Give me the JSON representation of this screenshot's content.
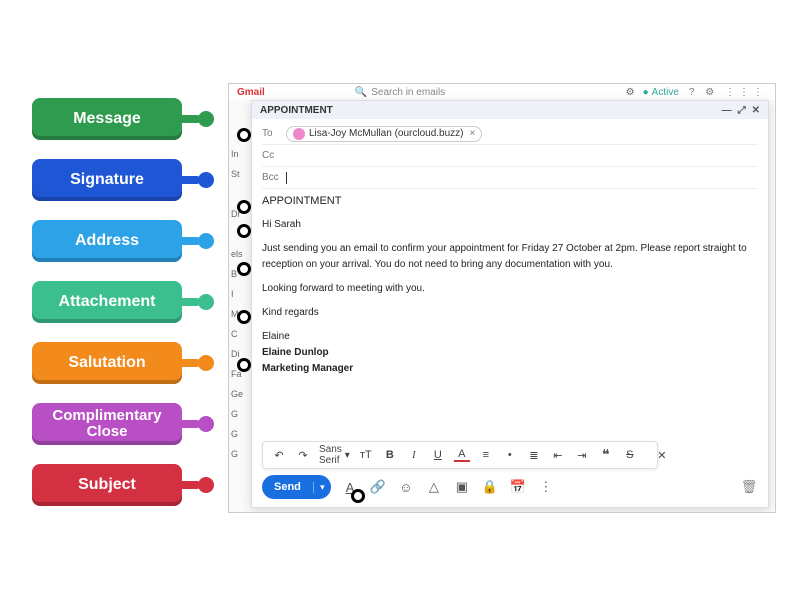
{
  "labels": [
    {
      "text": "Message"
    },
    {
      "text": "Signature"
    },
    {
      "text": "Address"
    },
    {
      "text": "Attachement"
    },
    {
      "text": "Salutation"
    },
    {
      "text": [
        "Complimentary",
        "Close"
      ]
    },
    {
      "text": "Subject"
    }
  ],
  "gmail": {
    "logo": "Gmail",
    "search_placeholder": "Search in emails",
    "status": "Active"
  },
  "compose": {
    "title": "APPOINTMENT",
    "to_label": "To",
    "cc_label": "Cc",
    "bcc_label": "Bcc",
    "recipient": "Lisa-Joy McMullan (ourcloud.buzz)",
    "subject": "APPOINTMENT",
    "greeting": "Hi Sarah",
    "body": "Just sending you an email to confirm your appointment for Friday 27 October at 2pm.  Please report straight to reception on your arrival. You do not need to bring any documentation with you.",
    "body2": "Looking forward to meeting with you.",
    "close": "Kind regards",
    "sig_name": "Elaine",
    "sig_full": "Elaine Dunlop",
    "sig_title": "Marketing Manager",
    "send": "Send",
    "font": "Sans Serif"
  },
  "toolbar_icons": {
    "undo": "↶",
    "redo": "↷",
    "size": "ᴛT",
    "bold": "B",
    "italic": "I",
    "underline": "U",
    "color": "A",
    "align": "≡",
    "bullets": "•",
    "numbered": "≣",
    "outdent": "⇤",
    "indent": "⇥",
    "quote": "❝",
    "strike": "S",
    "clear": "✕"
  },
  "bottom_icons": {
    "fmt": "A",
    "link": "🔗",
    "emoji": "☺",
    "drive": "△",
    "image": "▣",
    "lock": "🔒",
    "cal": "📅",
    "more": "⋮",
    "trash": "🗑"
  }
}
